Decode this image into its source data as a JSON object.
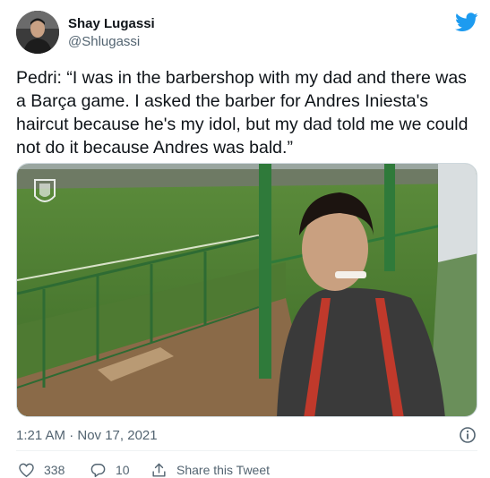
{
  "author": {
    "name": "Shay Lugassi",
    "handle": "@Shlugassi",
    "avatar_icon": "profile-photo"
  },
  "brand": {
    "logo_icon": "twitter-bird-icon",
    "color": "#1d9bf0"
  },
  "tweet": {
    "text": "Pedri: “I was in the barbershop with my dad and there was a Barça game. I asked the barber for Andres Iniesta's haircut because he's my idol, but my dad told me we could not do it because Andres was bald.”",
    "timestamp": "1:21 AM · Nov 17, 2021"
  },
  "media": {
    "type": "video-still",
    "description_icon": "spain-crest-icon"
  },
  "actions": {
    "like_count": "338",
    "reply_count": "10",
    "share_label": "Share this Tweet"
  },
  "colors": {
    "text": "#0f1419",
    "secondary": "#536471",
    "divider": "#eff3f4"
  }
}
